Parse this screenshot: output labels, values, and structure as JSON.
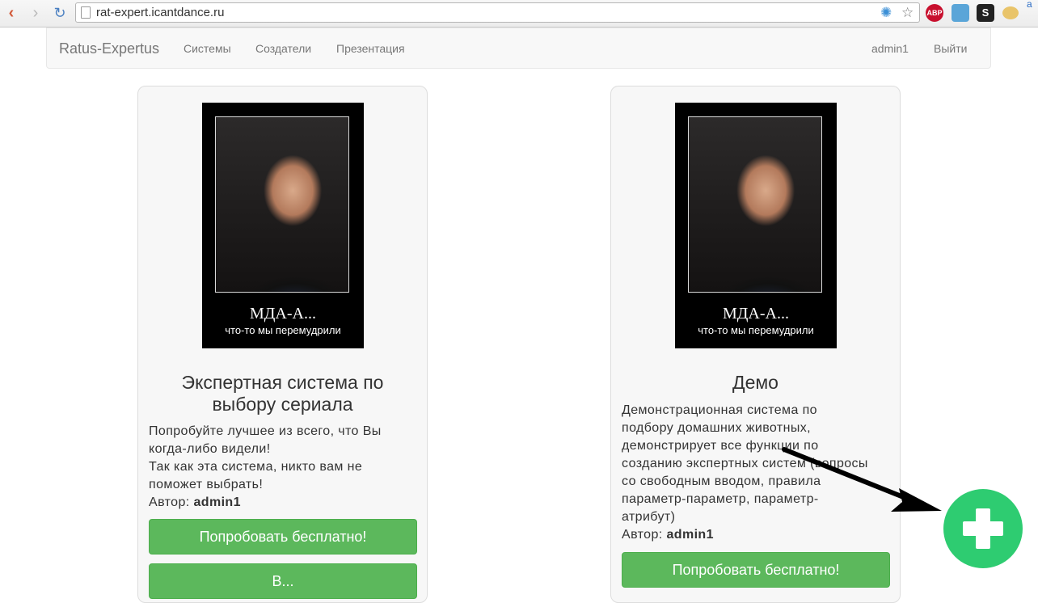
{
  "browser": {
    "url": "rat-expert.icantdance.ru",
    "back_icon": "‹",
    "forward_icon": "›",
    "reload_icon": "↻",
    "star_icon": "☆",
    "sparkle_icon": "✺",
    "ext_abp": "ABP",
    "ext_s": "S",
    "ext_a": "a"
  },
  "navbar": {
    "brand": "Ratus-Expertus",
    "links": [
      "Системы",
      "Создатели",
      "Презентация"
    ],
    "user": "admin1",
    "logout": "Выйти"
  },
  "cards": [
    {
      "poster_caption": "МДА-А...",
      "poster_subcaption": "что-то мы перемудрили",
      "title_line1": "Экспертная система по",
      "title_line2": "выбору сериала",
      "text_lines": [
        "Попробуйте лучшее из всего, что Вы",
        "когда-либо видели!",
        "Так как эта система, никто вам не",
        "поможет выбрать!"
      ],
      "author_label": "Автор:",
      "author": "admin1",
      "button": "Попробовать бесплатно!",
      "button2": "В..."
    },
    {
      "poster_caption": "МДА-А...",
      "poster_subcaption": "что-то мы перемудрили",
      "title_line1": "Демо",
      "text_lines": [
        "Демонстрационная система по",
        "подбору домашних животных,",
        "демонстрирует все функции по",
        "созданию экспертных систем (вопросы",
        "со свободным вводом, правила",
        "параметр-параметр, параметр-",
        "атрибут)"
      ],
      "author_label": "Автор:",
      "author": "admin1",
      "button": "Попробовать бесплатно!"
    }
  ],
  "add_button_icon": "plus-icon",
  "colors": {
    "accent_green": "#5cb85c",
    "add_green": "#2ecc71"
  }
}
